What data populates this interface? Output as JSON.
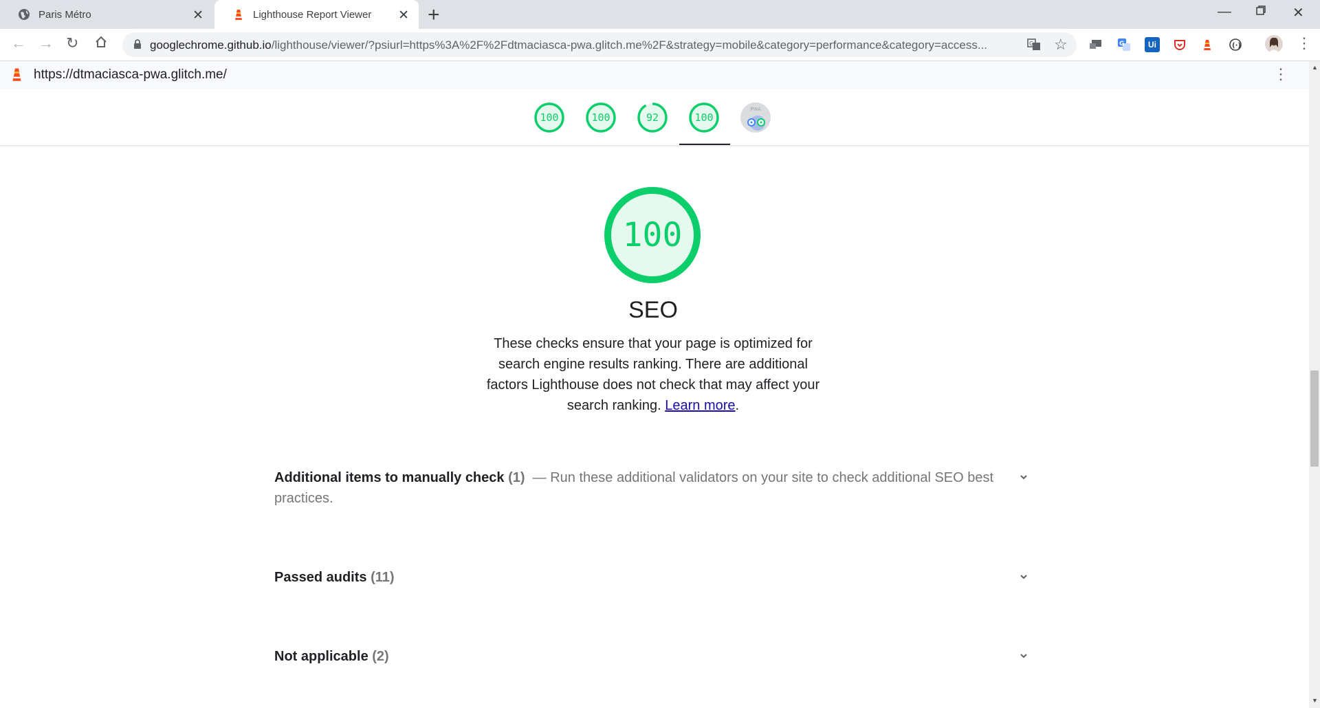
{
  "tabs": [
    {
      "title": "Paris Métro",
      "active": false
    },
    {
      "title": "Lighthouse Report Viewer",
      "active": true
    }
  ],
  "omnibox": {
    "host": "googlechrome.github.io",
    "path": "/lighthouse/viewer/?psiurl=https%3A%2F%2Fdtmaciasca-pwa.glitch.me%2F&strategy=mobile&category=performance&category=access..."
  },
  "report": {
    "url": "https://dtmaciasca-pwa.glitch.me/",
    "gauges": [
      {
        "score": "100",
        "value": 1.0
      },
      {
        "score": "100",
        "value": 1.0
      },
      {
        "score": "92",
        "value": 0.92
      },
      {
        "score": "100",
        "value": 1.0
      }
    ],
    "pwa_badge_label": "PWA",
    "category": {
      "score": "100",
      "value": 1.0,
      "title": "SEO",
      "description": "These checks ensure that your page is optimized for search engine results ranking. There are additional factors Lighthouse does not check that may affect your search ranking.",
      "learn_more": "Learn more",
      "period": "."
    },
    "groups": [
      {
        "title": "Additional items to manually check",
        "count": "(1)",
        "description": "— Run these additional validators on your site to check additional SEO best practices."
      },
      {
        "title": "Passed audits",
        "count": "(11)"
      },
      {
        "title": "Not applicable",
        "count": "(2)"
      }
    ]
  },
  "colors": {
    "pass": "#0cce6b",
    "pass_fill": "#e6f9ee",
    "accent_lighthouse": "#f44b21"
  }
}
